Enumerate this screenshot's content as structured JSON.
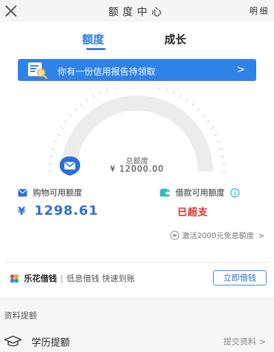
{
  "header": {
    "title": "额度中心",
    "detail": "明细"
  },
  "tabs": [
    {
      "label": "额度"
    },
    {
      "label": "成长"
    }
  ],
  "banner": {
    "text": "你有一份信用报告待领取",
    "arrow": ">"
  },
  "gauge": {
    "label": "总额度",
    "currency": "¥",
    "value": "12000.00",
    "display": "¥ 12000.00"
  },
  "shopping": {
    "title": "购物可用额度",
    "currency": "¥",
    "amount": "1298.61"
  },
  "loan": {
    "title": "借款可用额度",
    "status": "已超支"
  },
  "promo": {
    "text": "激活2000元免息额度",
    "arrow": ">"
  },
  "brand": {
    "name": "乐花借钱",
    "separator": "|",
    "slogan": "低息借钱 快速到账",
    "button": "立即借钱"
  },
  "section": {
    "title": "资料提额"
  },
  "education": {
    "label": "学历提额",
    "action": "提交资料 >"
  },
  "colors": {
    "accent": "#2a7de1",
    "banner": "#2f82e8",
    "alert": "#e02a2a"
  },
  "icons": [
    "close-icon",
    "report-icon",
    "envelope-icon",
    "wallet-icon",
    "info-icon",
    "ticket-icon",
    "brand-logo-icon",
    "graduation-cap-icon"
  ]
}
